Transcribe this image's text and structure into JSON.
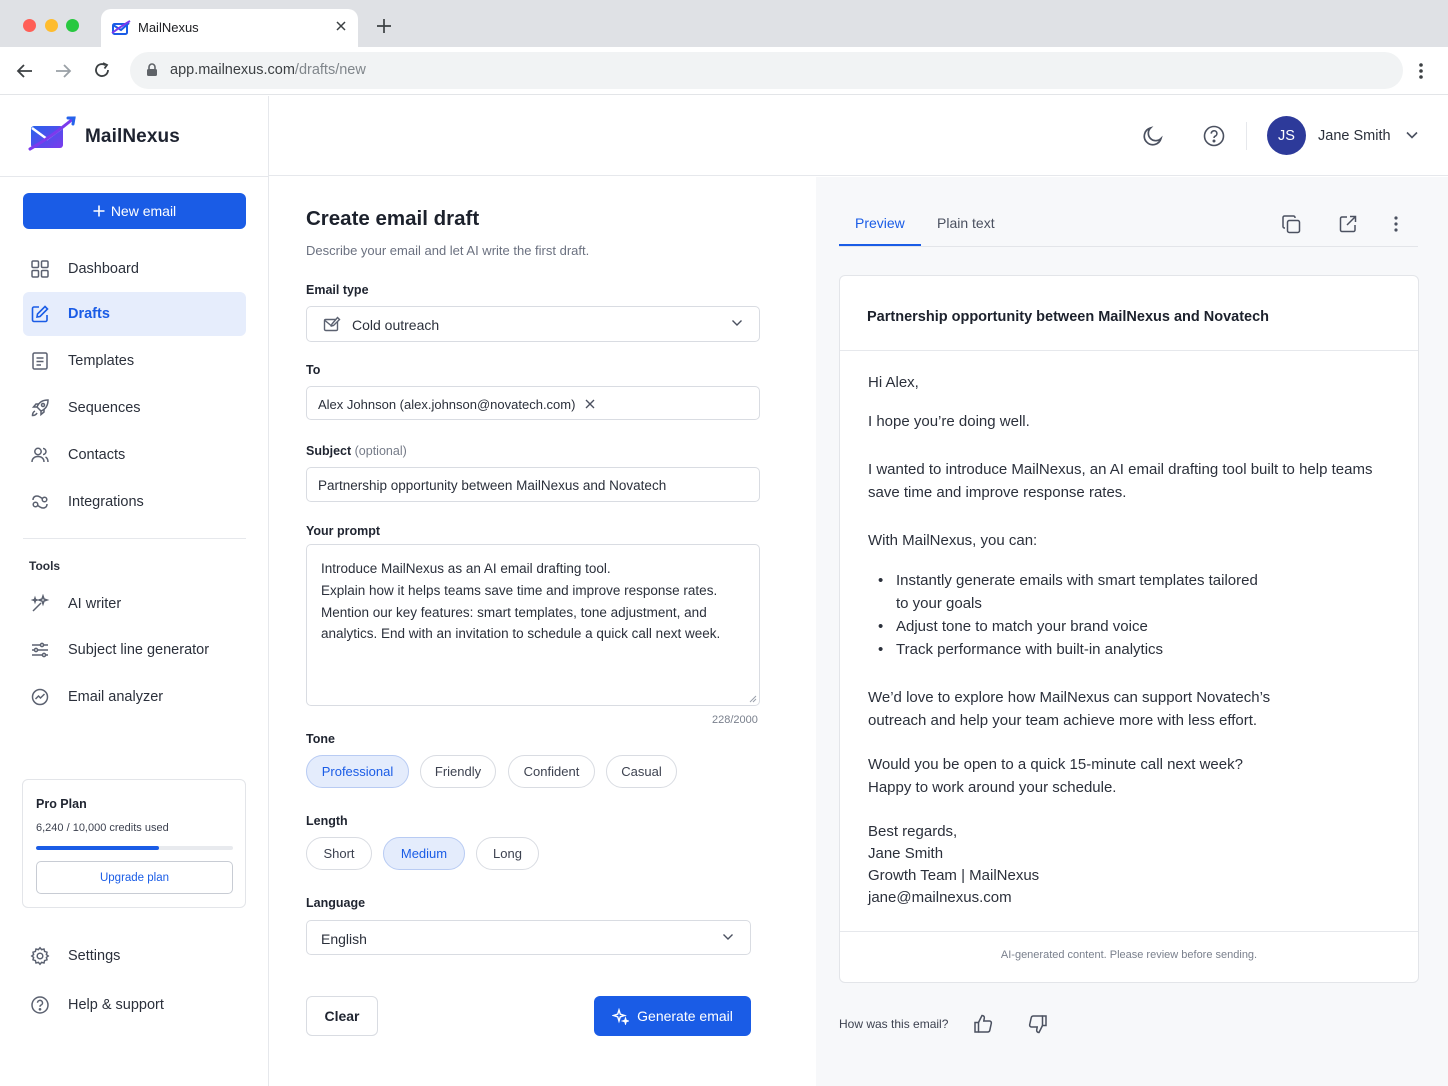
{
  "browser": {
    "tab_title": "MailNexus",
    "url_domain": "app.mailnexus.com",
    "url_path": "/drafts/new"
  },
  "brand": {
    "name": "MailNexus"
  },
  "sidebar": {
    "new_email_label": "New email",
    "nav": [
      {
        "label": "Dashboard",
        "icon": "grid-icon"
      },
      {
        "label": "Drafts",
        "icon": "edit-icon",
        "active": true
      },
      {
        "label": "Templates",
        "icon": "document-icon"
      },
      {
        "label": "Sequences",
        "icon": "rocket-icon"
      },
      {
        "label": "Contacts",
        "icon": "users-icon"
      },
      {
        "label": "Integrations",
        "icon": "integrations-icon"
      }
    ],
    "tools_label": "Tools",
    "tools": [
      {
        "label": "AI writer",
        "icon": "sparkle-wand-icon"
      },
      {
        "label": "Subject line generator",
        "icon": "sliders-icon"
      },
      {
        "label": "Email analyzer",
        "icon": "analyzer-icon"
      }
    ],
    "plan": {
      "title": "Pro Plan",
      "usage": "6,240 / 10,000 credits used",
      "used_fraction": 0.624,
      "upgrade_label": "Upgrade plan"
    },
    "footer": [
      {
        "label": "Settings",
        "icon": "gear-icon"
      },
      {
        "label": "Help & support",
        "icon": "help-icon"
      }
    ]
  },
  "header": {
    "avatar_initials": "JS",
    "user_name": "Jane Smith"
  },
  "form": {
    "title": "Create email draft",
    "subtitle": "Describe your email and let AI write the first draft.",
    "email_type_label": "Email type",
    "email_type_value": "Cold outreach",
    "to_label": "To",
    "to_chip": "Alex Johnson (alex.johnson@novatech.com)",
    "subject_label": "Subject",
    "subject_optional": "(optional)",
    "subject_value": "Partnership opportunity between MailNexus and Novatech",
    "prompt_label": "Your prompt",
    "prompt_value": "Introduce MailNexus as an AI email drafting tool.\nExplain how it helps teams save time and improve response rates. Mention our key features: smart templates, tone adjustment, and analytics. End with an invitation to schedule a quick call next week.",
    "char_count": "228/2000",
    "tone_label": "Tone",
    "tones": [
      "Professional",
      "Friendly",
      "Confident",
      "Casual"
    ],
    "tone_selected": "Professional",
    "length_label": "Length",
    "lengths": [
      "Short",
      "Medium",
      "Long"
    ],
    "length_selected": "Medium",
    "language_label": "Language",
    "language_value": "English",
    "clear_label": "Clear",
    "generate_label": "Generate email"
  },
  "preview": {
    "tab_preview": "Preview",
    "tab_plain": "Plain text",
    "subject": "Partnership opportunity between MailNexus and Novatech",
    "greeting": "Hi Alex,",
    "hope": "I hope you’re doing well.",
    "intro": "I wanted to introduce MailNexus, an AI email drafting tool built to help teams save time and improve response rates.",
    "with": "With MailNexus, you can:",
    "bullets": [
      "Instantly generate emails with smart templates tailored to your goals",
      "Adjust tone to match your brand voice",
      "Track performance with built-in analytics"
    ],
    "love": "We’d love to explore how MailNexus can support Novatech’s outreach and help your team achieve more with less effort.",
    "call": "Would you be open to a quick 15-minute call next week? Happy to work around your schedule.",
    "signoff": "Best regards,",
    "sig_name": "Jane Smith",
    "sig_team": "Growth Team | MailNexus",
    "sig_email": "jane@mailnexus.com",
    "disclaimer": "AI-generated content. Please review before sending.",
    "feedback_label": "How was this email?"
  },
  "colors": {
    "accent": "#1a5ce6",
    "avatar": "#2d3a9a",
    "active_nav_bg": "#e6edfc"
  }
}
